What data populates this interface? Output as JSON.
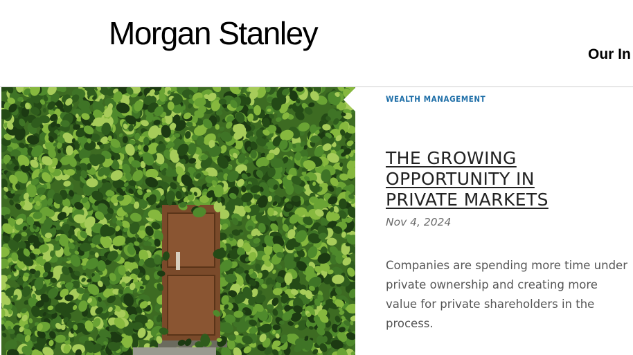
{
  "header": {
    "logo_text": "Morgan Stanley",
    "nav_item": "Our In"
  },
  "article": {
    "category": "WEALTH MANAGEMENT",
    "title": "THE GROWING OPPORTUNITY IN PRIVATE MARKETS",
    "date": "Nov 4, 2024",
    "summary": "Companies are spending more time under private ownership and creating more value for private shareholders in the process."
  },
  "colors": {
    "category": "#1f6fa8",
    "ivy_dark": "#2e5a1c",
    "ivy_light": "#8fbf3a",
    "door": "#7a4a2a"
  }
}
